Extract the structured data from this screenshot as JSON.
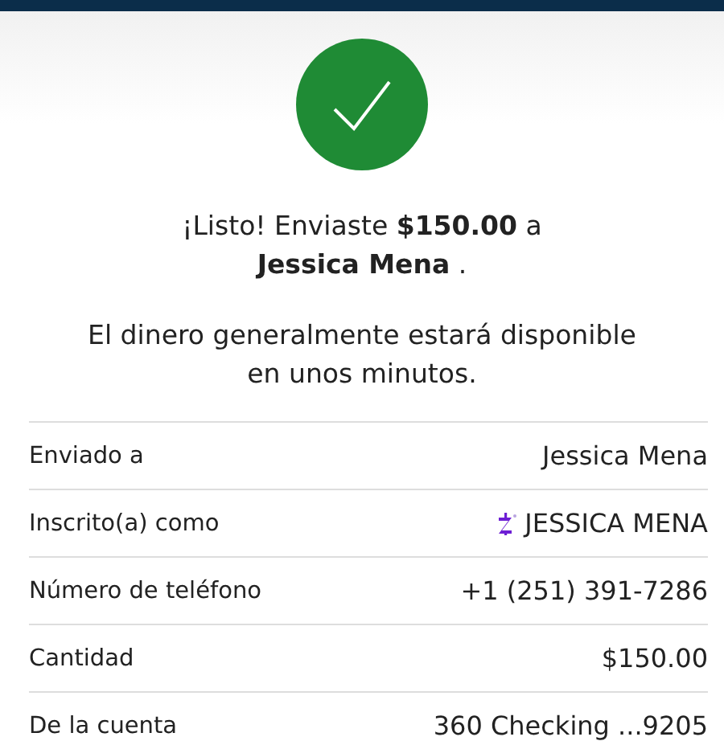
{
  "confirmation": {
    "message": "¡Listo! Enviaste **$150.00** a\n**Jessica Mena** .",
    "note": "El dinero generalmente estará disponible\nen unos minutos."
  },
  "details": [
    {
      "kind": "text",
      "label": "Enviado a",
      "value": "Jessica Mena"
    },
    {
      "kind": "enrolled",
      "label": "Inscrito(a) como",
      "value": "JESSICA MENA"
    },
    {
      "kind": "text",
      "label": "Número de teléfono",
      "value": "+1 (251) 391-7286"
    },
    {
      "kind": "text",
      "label": "Cantidad",
      "value": "$150.00"
    },
    {
      "kind": "text",
      "label": "De la cuenta",
      "value": "360 Checking ...9205"
    }
  ]
}
